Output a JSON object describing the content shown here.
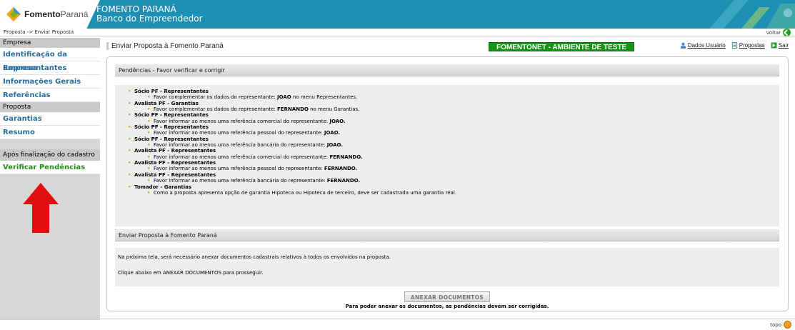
{
  "header": {
    "logo_bold": "Fomento",
    "logo_light": "Paraná",
    "title_line1": "FOMENTO PARANÁ",
    "title_line2": "Banco do Empreendedor"
  },
  "breadcrumb": "Proposta -> Enviar Proposta",
  "voltar": "voltar",
  "sidebar": {
    "section1": "Empresa",
    "items1": [
      "Identificação da Empresa",
      "Representantes",
      "Informações Gerais",
      "Referências"
    ],
    "section2": "Proposta",
    "items2": [
      "Garantias",
      "Resumo"
    ],
    "section3": "Após finalização do cadastro",
    "items3": [
      "Verificar Pendências"
    ]
  },
  "main": {
    "title": "Enviar Proposta à Fomento Paraná",
    "env_badge": "FOMENTONET - AMBIENTE DE TESTE",
    "links": [
      "Dados Usuário",
      "Propostas",
      "Sair"
    ]
  },
  "pendencias": {
    "header": "Pendências - Favor verificar e corrigir",
    "items": [
      {
        "group": "Sócio PF - Representantes",
        "msg_pre": "Favor complementar os dados do representante: ",
        "msg_bold": "JOAO",
        "msg_post": " no menu Representantes."
      },
      {
        "group": "Avalista PF - Garantias",
        "msg_pre": "Favor complementar os dados do representante: ",
        "msg_bold": "FERNANDO",
        "msg_post": " no menu Garantias."
      },
      {
        "group": "Sócio PF - Representantes",
        "msg_pre": "Favor informar ao menos uma referência comercial do representante: ",
        "msg_bold": "JOAO.",
        "msg_post": ""
      },
      {
        "group": "Sócio PF - Representantes",
        "msg_pre": "Favor informar ao menos uma referência pessoal do representante: ",
        "msg_bold": "JOAO.",
        "msg_post": ""
      },
      {
        "group": "Sócio PF - Representantes",
        "msg_pre": "Favor informar ao menos uma referência bancária do representante: ",
        "msg_bold": "JOAO.",
        "msg_post": ""
      },
      {
        "group": "Avalista PF - Representantes",
        "msg_pre": "Favor informar ao menos uma referência comercial do representante: ",
        "msg_bold": "FERNANDO.",
        "msg_post": ""
      },
      {
        "group": "Avalista PF - Representantes",
        "msg_pre": "Favor informar ao menos uma referência pessoal do representante: ",
        "msg_bold": "FERNANDO.",
        "msg_post": ""
      },
      {
        "group": "Avalista PF - Representantes",
        "msg_pre": "Favor informar ao menos uma referência bancária do representante: ",
        "msg_bold": "FERNANDO.",
        "msg_post": ""
      },
      {
        "group": "Tomador - Garantias",
        "msg_pre": "Como a proposta apresenta opção de garantia Hipoteca ou Hipoteca de terceiro, deve ser cadastrada uma garantia real.",
        "msg_bold": "",
        "msg_post": ""
      }
    ]
  },
  "envio": {
    "header": "Enviar Proposta à Fomento Paraná",
    "line1": "Na próxima tela, será necessário anexar documentos cadastrais relativos à todos os envolvidos na proposta.",
    "line2": "Clique abaixo em ANEXAR DOCUMENTOS para prosseguir.",
    "button": "ANEXAR DOCUMENTOS",
    "note": "Para poder anexar os documentos, as pendências devem ser corrigidas."
  },
  "footer": {
    "topo": "topo"
  },
  "colors": {
    "header_bg": "#1d8fb5",
    "badge_bg": "#159416",
    "link_blue": "#2a6e9e",
    "link_green": "#2e8b1f",
    "bullet": "#e89a18",
    "arrow": "#e01010"
  }
}
